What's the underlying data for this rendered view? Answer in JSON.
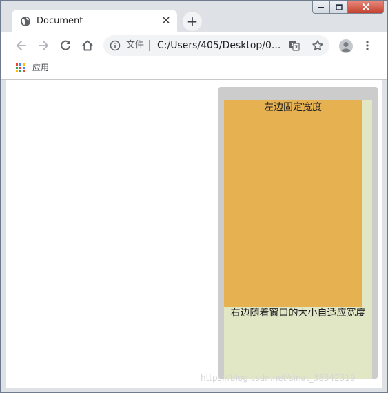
{
  "tab": {
    "title": "Document",
    "close_glyph": "✕",
    "favicon": "globe-icon"
  },
  "new_tab_glyph": "+",
  "address_bar": {
    "scheme_label": "文件",
    "url": "C:/Users/405/Desktop/0..."
  },
  "bookmarks": {
    "apps_label": "应用"
  },
  "page": {
    "left_panel_text": "左边固定宽度",
    "right_panel_text": "右边随着窗口的大小自适应宽度",
    "watermark": "https://blog.csdn.net/sinat_38342319"
  },
  "colors": {
    "container": "#cccccc",
    "left_panel": "#e6b150",
    "right_panel": "#e1e6c4"
  }
}
